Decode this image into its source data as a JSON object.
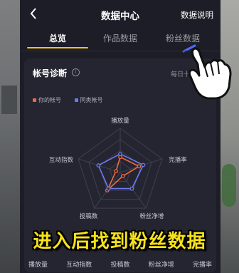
{
  "header": {
    "title": "数据中心",
    "explain_label": "数据说明"
  },
  "tabs": [
    {
      "label": "总览",
      "active": true
    },
    {
      "label": "作品数据",
      "active": false
    },
    {
      "label": "粉丝数据",
      "active": false
    }
  ],
  "card": {
    "title": "帐号诊断",
    "update_note": "每日十点更新",
    "legend": [
      {
        "label": "你的帐号",
        "color": "#f26b3a"
      },
      {
        "label": "同类帐号",
        "color": "#6a7cf5"
      }
    ]
  },
  "chart_data": {
    "type": "radar",
    "axes": [
      "播放量",
      "完播率",
      "粉丝净增",
      "投稿数",
      "互动指数"
    ],
    "series": [
      {
        "name": "你的帐号",
        "color": "#f26b3a",
        "values": [
          0.35,
          0.45,
          0.1,
          0.5,
          0.1
        ]
      },
      {
        "name": "同类帐号",
        "color": "#6a7cf5",
        "values": [
          0.42,
          0.55,
          0.45,
          0.45,
          0.52
        ]
      }
    ],
    "levels": 4
  },
  "bottom_metrics": [
    "播放量",
    "互动指数",
    "投稿数",
    "粉丝净增",
    "完播率"
  ],
  "overlay_caption": "进入后找到粉丝数据"
}
